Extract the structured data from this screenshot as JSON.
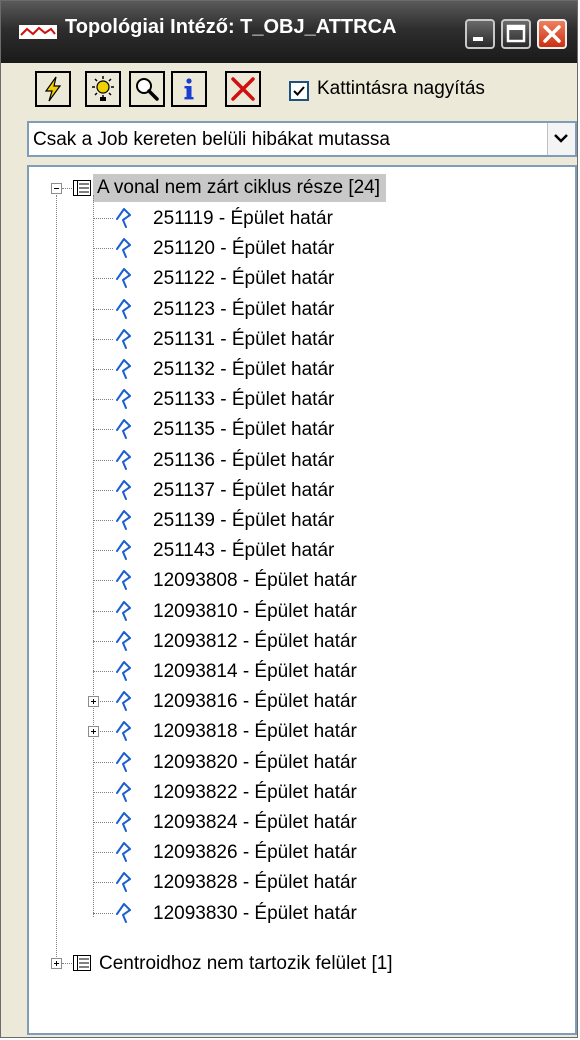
{
  "window": {
    "title": "Topológiai Intéző: T_OBJ_ATTRCA"
  },
  "toolbar": {
    "buttons": [
      {
        "icon": "lightning-icon",
        "color": "#e8c000"
      },
      {
        "icon": "sun-bulb-icon",
        "color": "#e8c000"
      },
      {
        "icon": "magnifier-icon"
      },
      {
        "icon": "info-icon",
        "color": "#1a3fd0"
      },
      {
        "icon": "delete-icon",
        "color": "#d01010"
      }
    ],
    "zoom_on_click": {
      "label": "Kattintásra nagyítás",
      "checked": true
    }
  },
  "filter": {
    "selected": "Csak a  Job kereten belüli hibákat mutassa"
  },
  "tree": {
    "root_label": "A vonal nem zárt ciklus része [24]",
    "items": [
      {
        "label": "251119 - Épület határ",
        "expandable": false
      },
      {
        "label": "251120 - Épület határ",
        "expandable": false
      },
      {
        "label": "251122 - Épület határ",
        "expandable": false
      },
      {
        "label": "251123 - Épület határ",
        "expandable": false
      },
      {
        "label": "251131 - Épület határ",
        "expandable": false
      },
      {
        "label": "251132 - Épület határ",
        "expandable": false
      },
      {
        "label": "251133 - Épület határ",
        "expandable": false
      },
      {
        "label": "251135 - Épület határ",
        "expandable": false
      },
      {
        "label": "251136 - Épület határ",
        "expandable": false
      },
      {
        "label": "251137 - Épület határ",
        "expandable": false
      },
      {
        "label": "251139 - Épület határ",
        "expandable": false
      },
      {
        "label": "251143 - Épület határ",
        "expandable": false
      },
      {
        "label": "12093808 - Épület határ",
        "expandable": false
      },
      {
        "label": "12093810 - Épület határ",
        "expandable": false
      },
      {
        "label": "12093812 - Épület határ",
        "expandable": false
      },
      {
        "label": "12093814 - Épület határ",
        "expandable": false
      },
      {
        "label": "12093816 - Épület határ",
        "expandable": true
      },
      {
        "label": "12093818 - Épület határ",
        "expandable": true
      },
      {
        "label": "12093820 - Épület határ",
        "expandable": false
      },
      {
        "label": "12093822 - Épület határ",
        "expandable": false
      },
      {
        "label": "12093824 - Épület határ",
        "expandable": false
      },
      {
        "label": "12093826 - Épület határ",
        "expandable": false
      },
      {
        "label": "12093828 - Épület határ",
        "expandable": false
      },
      {
        "label": "12093830 - Épület határ",
        "expandable": false
      }
    ],
    "second_root_label": "Centroidhoz nem tartozik felület [1]"
  },
  "colors": {
    "accent": "#1a5fd0",
    "selection": "#c8c8c8",
    "close_button": "#d84a20"
  }
}
